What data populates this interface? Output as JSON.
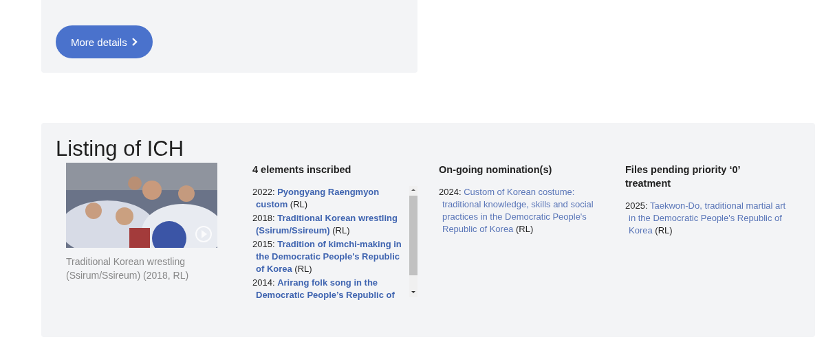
{
  "more_button": {
    "label": "More details"
  },
  "listing": {
    "title": "Listing of ICH",
    "video": {
      "kind": "picture",
      "caption": "Traditional Korean wrestling (Ssirum/Ssireum) (2018, RL)"
    },
    "inscribed": {
      "heading": "4 elements inscribed",
      "items": [
        {
          "year": "2022:",
          "title": "Pyongyang Raengmyon custom",
          "tag": "(RL)"
        },
        {
          "year": "2018:",
          "title": "Traditional Korean wrestling (Ssirum/Ssireum)",
          "tag": "(RL)"
        },
        {
          "year": "2015:",
          "title": "Tradition of kimchi-making in the Democratic People's Republic of Korea",
          "tag": "(RL)"
        },
        {
          "year": "2014:",
          "title": "Arirang folk song in the Democratic People’s Republic of"
        }
      ]
    },
    "columns": [
      {
        "heading": "On-going nomination(s)",
        "items": [
          {
            "year": "2024:",
            "title": "Custom of Korean costume: traditional knowledge, skills and social practices in the Democratic People's Republic of Korea",
            "tag": "(RL)"
          }
        ]
      },
      {
        "heading": "Files pending priority ‘0’ treatment",
        "items": [
          {
            "year": "2025:",
            "title": "Taekwon-Do, traditional martial art in the Democratic People's Republic of Korea",
            "tag": "(RL)"
          }
        ]
      }
    ]
  }
}
